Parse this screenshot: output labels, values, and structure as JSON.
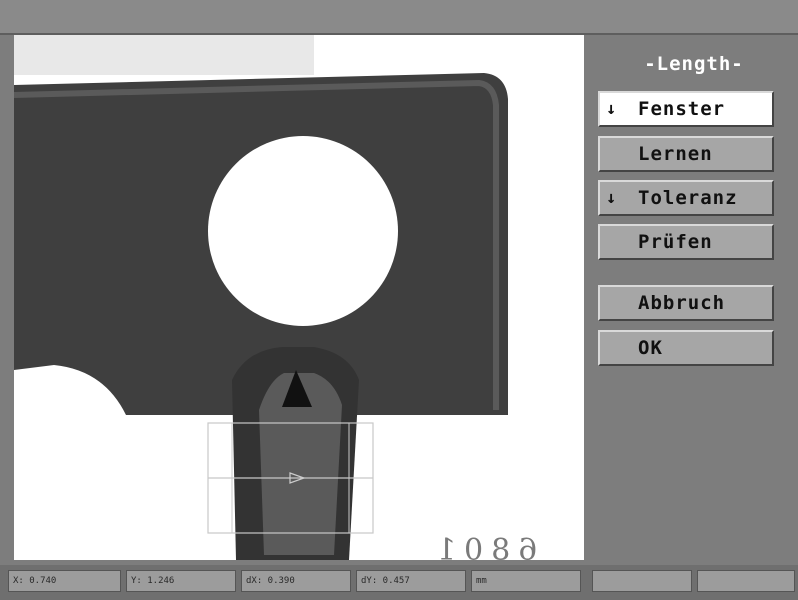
{
  "sidepanel": {
    "title": "-Length-",
    "buttons": [
      {
        "label": "Fenster",
        "arrow": "↓",
        "active": true
      },
      {
        "label": "Lernen",
        "arrow": "",
        "active": false
      },
      {
        "label": "Toleranz",
        "arrow": "↓",
        "active": false
      },
      {
        "label": "Prüfen",
        "arrow": "",
        "active": false
      },
      {
        "label": "Abbruch",
        "arrow": "",
        "active": false
      },
      {
        "label": "OK",
        "arrow": "",
        "active": false
      }
    ]
  },
  "image": {
    "stamp_text": "6801"
  },
  "status": {
    "x": "X: 0.740",
    "y": "Y: 1.246",
    "dx": "dX: 0.390",
    "dy": "dY: 0.457",
    "unit": "mm"
  },
  "colors": {
    "part": "#3a3a3a",
    "background": "#ffffff",
    "panel": "#7d7d7d"
  }
}
